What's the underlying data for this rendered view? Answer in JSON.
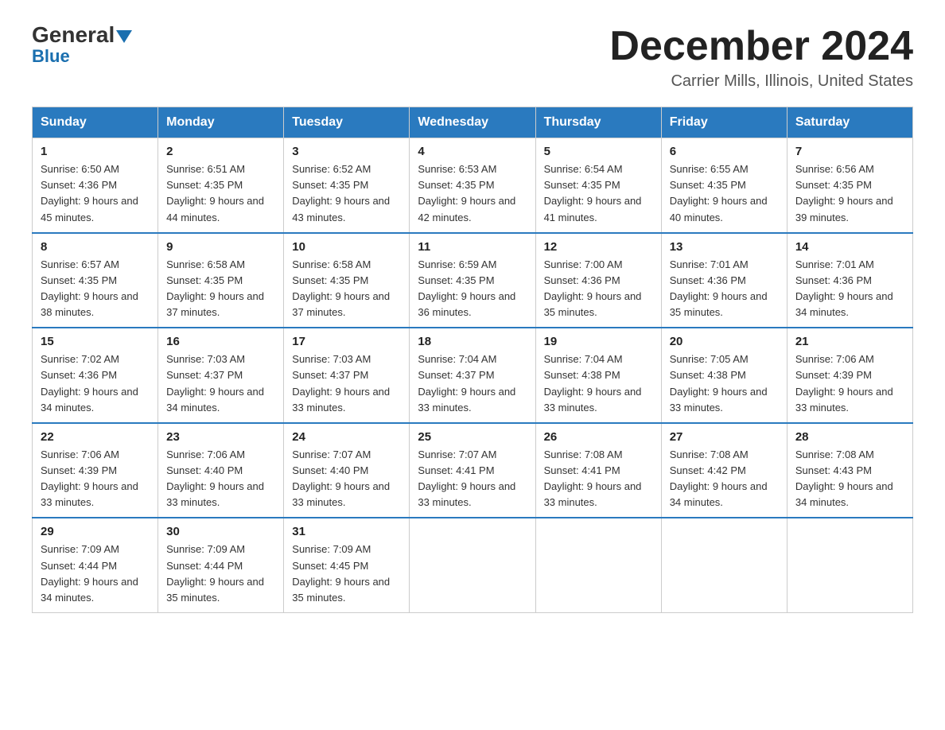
{
  "logo": {
    "text1": "General",
    "text2": "Blue"
  },
  "title": "December 2024",
  "subtitle": "Carrier Mills, Illinois, United States",
  "weekdays": [
    "Sunday",
    "Monday",
    "Tuesday",
    "Wednesday",
    "Thursday",
    "Friday",
    "Saturday"
  ],
  "weeks": [
    [
      {
        "day": "1",
        "sunrise": "6:50 AM",
        "sunset": "4:36 PM",
        "daylight": "9 hours and 45 minutes."
      },
      {
        "day": "2",
        "sunrise": "6:51 AM",
        "sunset": "4:35 PM",
        "daylight": "9 hours and 44 minutes."
      },
      {
        "day": "3",
        "sunrise": "6:52 AM",
        "sunset": "4:35 PM",
        "daylight": "9 hours and 43 minutes."
      },
      {
        "day": "4",
        "sunrise": "6:53 AM",
        "sunset": "4:35 PM",
        "daylight": "9 hours and 42 minutes."
      },
      {
        "day": "5",
        "sunrise": "6:54 AM",
        "sunset": "4:35 PM",
        "daylight": "9 hours and 41 minutes."
      },
      {
        "day": "6",
        "sunrise": "6:55 AM",
        "sunset": "4:35 PM",
        "daylight": "9 hours and 40 minutes."
      },
      {
        "day": "7",
        "sunrise": "6:56 AM",
        "sunset": "4:35 PM",
        "daylight": "9 hours and 39 minutes."
      }
    ],
    [
      {
        "day": "8",
        "sunrise": "6:57 AM",
        "sunset": "4:35 PM",
        "daylight": "9 hours and 38 minutes."
      },
      {
        "day": "9",
        "sunrise": "6:58 AM",
        "sunset": "4:35 PM",
        "daylight": "9 hours and 37 minutes."
      },
      {
        "day": "10",
        "sunrise": "6:58 AM",
        "sunset": "4:35 PM",
        "daylight": "9 hours and 37 minutes."
      },
      {
        "day": "11",
        "sunrise": "6:59 AM",
        "sunset": "4:35 PM",
        "daylight": "9 hours and 36 minutes."
      },
      {
        "day": "12",
        "sunrise": "7:00 AM",
        "sunset": "4:36 PM",
        "daylight": "9 hours and 35 minutes."
      },
      {
        "day": "13",
        "sunrise": "7:01 AM",
        "sunset": "4:36 PM",
        "daylight": "9 hours and 35 minutes."
      },
      {
        "day": "14",
        "sunrise": "7:01 AM",
        "sunset": "4:36 PM",
        "daylight": "9 hours and 34 minutes."
      }
    ],
    [
      {
        "day": "15",
        "sunrise": "7:02 AM",
        "sunset": "4:36 PM",
        "daylight": "9 hours and 34 minutes."
      },
      {
        "day": "16",
        "sunrise": "7:03 AM",
        "sunset": "4:37 PM",
        "daylight": "9 hours and 34 minutes."
      },
      {
        "day": "17",
        "sunrise": "7:03 AM",
        "sunset": "4:37 PM",
        "daylight": "9 hours and 33 minutes."
      },
      {
        "day": "18",
        "sunrise": "7:04 AM",
        "sunset": "4:37 PM",
        "daylight": "9 hours and 33 minutes."
      },
      {
        "day": "19",
        "sunrise": "7:04 AM",
        "sunset": "4:38 PM",
        "daylight": "9 hours and 33 minutes."
      },
      {
        "day": "20",
        "sunrise": "7:05 AM",
        "sunset": "4:38 PM",
        "daylight": "9 hours and 33 minutes."
      },
      {
        "day": "21",
        "sunrise": "7:06 AM",
        "sunset": "4:39 PM",
        "daylight": "9 hours and 33 minutes."
      }
    ],
    [
      {
        "day": "22",
        "sunrise": "7:06 AM",
        "sunset": "4:39 PM",
        "daylight": "9 hours and 33 minutes."
      },
      {
        "day": "23",
        "sunrise": "7:06 AM",
        "sunset": "4:40 PM",
        "daylight": "9 hours and 33 minutes."
      },
      {
        "day": "24",
        "sunrise": "7:07 AM",
        "sunset": "4:40 PM",
        "daylight": "9 hours and 33 minutes."
      },
      {
        "day": "25",
        "sunrise": "7:07 AM",
        "sunset": "4:41 PM",
        "daylight": "9 hours and 33 minutes."
      },
      {
        "day": "26",
        "sunrise": "7:08 AM",
        "sunset": "4:41 PM",
        "daylight": "9 hours and 33 minutes."
      },
      {
        "day": "27",
        "sunrise": "7:08 AM",
        "sunset": "4:42 PM",
        "daylight": "9 hours and 34 minutes."
      },
      {
        "day": "28",
        "sunrise": "7:08 AM",
        "sunset": "4:43 PM",
        "daylight": "9 hours and 34 minutes."
      }
    ],
    [
      {
        "day": "29",
        "sunrise": "7:09 AM",
        "sunset": "4:44 PM",
        "daylight": "9 hours and 34 minutes."
      },
      {
        "day": "30",
        "sunrise": "7:09 AM",
        "sunset": "4:44 PM",
        "daylight": "9 hours and 35 minutes."
      },
      {
        "day": "31",
        "sunrise": "7:09 AM",
        "sunset": "4:45 PM",
        "daylight": "9 hours and 35 minutes."
      },
      null,
      null,
      null,
      null
    ]
  ]
}
